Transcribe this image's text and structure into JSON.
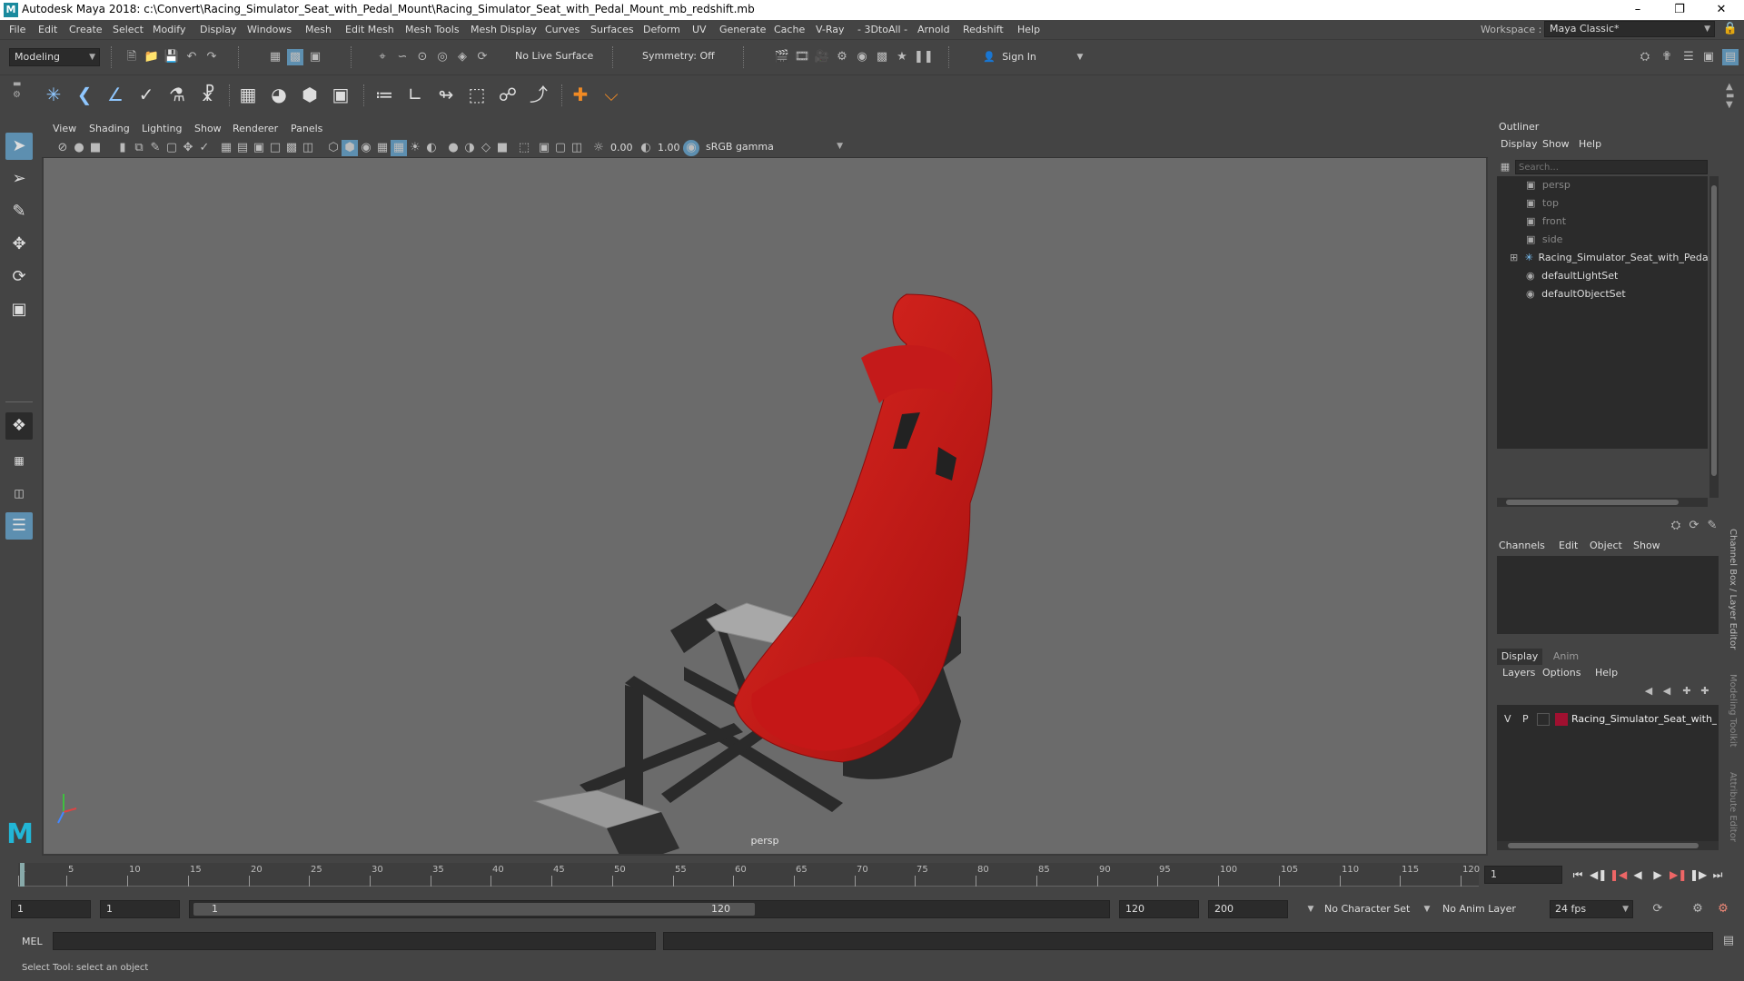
{
  "window": {
    "title": "Autodesk Maya 2018: c:\\Convert\\Racing_Simulator_Seat_with_Pedal_Mount\\Racing_Simulator_Seat_with_Pedal_Mount_mb_redshift.mb",
    "logo_letter": "M"
  },
  "menubar": {
    "items": [
      "File",
      "Edit",
      "Create",
      "Select",
      "Modify",
      "Display",
      "Windows",
      "Mesh",
      "Edit Mesh",
      "Mesh Tools",
      "Mesh Display",
      "Curves",
      "Surfaces",
      "Deform",
      "UV",
      "Generate",
      "Cache",
      "V-Ray",
      "- 3DtoAll -",
      "Arnold",
      "Redshift",
      "Help"
    ],
    "workspace_label": "Workspace :",
    "workspace_value": "Maya Classic*"
  },
  "statusline": {
    "mode": "Modeling",
    "live_surface": "No Live Surface",
    "symmetry": "Symmetry: Off",
    "sign_in": "Sign In"
  },
  "viewport": {
    "menu": [
      "View",
      "Shading",
      "Lighting",
      "Show",
      "Renderer",
      "Panels"
    ],
    "exposure": "0.00",
    "gamma": "1.00",
    "color_space": "sRGB gamma",
    "camera_label": "persp"
  },
  "outliner": {
    "title": "Outliner",
    "menu": [
      "Display",
      "Show",
      "Help"
    ],
    "search_placeholder": "Search...",
    "items": [
      {
        "label": "persp",
        "type": "camera"
      },
      {
        "label": "top",
        "type": "camera"
      },
      {
        "label": "front",
        "type": "camera"
      },
      {
        "label": "side",
        "type": "camera"
      },
      {
        "label": "Racing_Simulator_Seat_with_Pedal_Mou",
        "type": "group"
      },
      {
        "label": "defaultLightSet",
        "type": "set"
      },
      {
        "label": "defaultObjectSet",
        "type": "set"
      }
    ]
  },
  "channelbox": {
    "menu": [
      "Channels",
      "Edit",
      "Object",
      "Show"
    ]
  },
  "layereditor": {
    "tabs": [
      "Display",
      "Anim"
    ],
    "menu": [
      "Layers",
      "Options",
      "Help"
    ],
    "layer": {
      "v": "V",
      "p": "P",
      "name": "Racing_Simulator_Seat_with_P",
      "color": "#a01030"
    }
  },
  "rightstrip": {
    "tabs": [
      "Channel Box / Layer Editor",
      "Modeling Toolkit",
      "Attribute Editor"
    ]
  },
  "timeline": {
    "ticks": [
      "1",
      "5",
      "10",
      "15",
      "20",
      "25",
      "30",
      "35",
      "40",
      "45",
      "50",
      "55",
      "60",
      "65",
      "70",
      "75",
      "80",
      "85",
      "90",
      "95",
      "100",
      "105",
      "110",
      "115",
      "120"
    ],
    "current_frame": "1"
  },
  "range": {
    "start": "1",
    "start2": "1",
    "slider_start": "1",
    "slider_end": "120",
    "end": "120",
    "end2": "200",
    "character_set": "No Character Set",
    "anim_layer": "No Anim Layer",
    "fps": "24 fps"
  },
  "cmdline": {
    "label": "MEL"
  },
  "helpline": {
    "text": "Select Tool: select an object"
  },
  "colors": {
    "accent": "#5d8fb0",
    "seat_red": "#d11a1a",
    "frame_dark": "#2a2a2a"
  }
}
